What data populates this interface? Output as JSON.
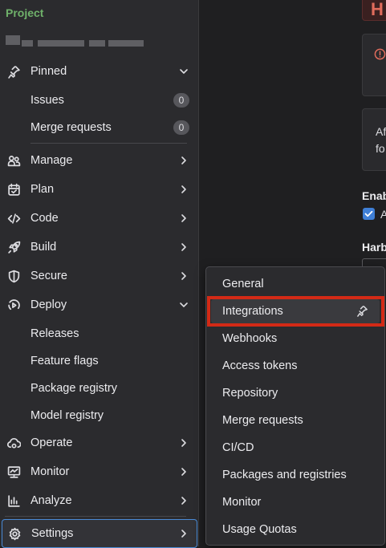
{
  "sidebar": {
    "context_label": "Project",
    "pinned": {
      "label": "Pinned",
      "items": [
        {
          "label": "Issues",
          "count": "0"
        },
        {
          "label": "Merge requests",
          "count": "0"
        }
      ]
    },
    "groups": {
      "manage": "Manage",
      "plan": "Plan",
      "code": "Code",
      "build": "Build",
      "secure": "Secure",
      "deploy": "Deploy",
      "operate": "Operate",
      "monitor": "Monitor",
      "analyze": "Analyze",
      "settings": "Settings"
    },
    "deploy_items": [
      "Releases",
      "Feature flags",
      "Package registry",
      "Model registry"
    ]
  },
  "main": {
    "top_button_text": "H",
    "info_line_1": "Af",
    "info_line_2": "fo",
    "enable_label": "Enab",
    "enable_checkbox_text": "A",
    "enable_checked": true,
    "harbor_label": "Harb"
  },
  "settings_flyout": {
    "items": [
      "General",
      "Integrations",
      "Webhooks",
      "Access tokens",
      "Repository",
      "Merge requests",
      "CI/CD",
      "Packages and registries",
      "Monitor",
      "Usage Quotas"
    ],
    "hovered_item": "Integrations",
    "hovered_item_action_icon": "pin-icon"
  },
  "colors": {
    "sidebar_bg": "#2b2b2e",
    "page_bg": "#1f1f21",
    "project_label": "#6fb16a",
    "highlight_frame": "#d32a16",
    "active_border": "#4a8bd6",
    "checkbox": "#3f7fd6"
  }
}
